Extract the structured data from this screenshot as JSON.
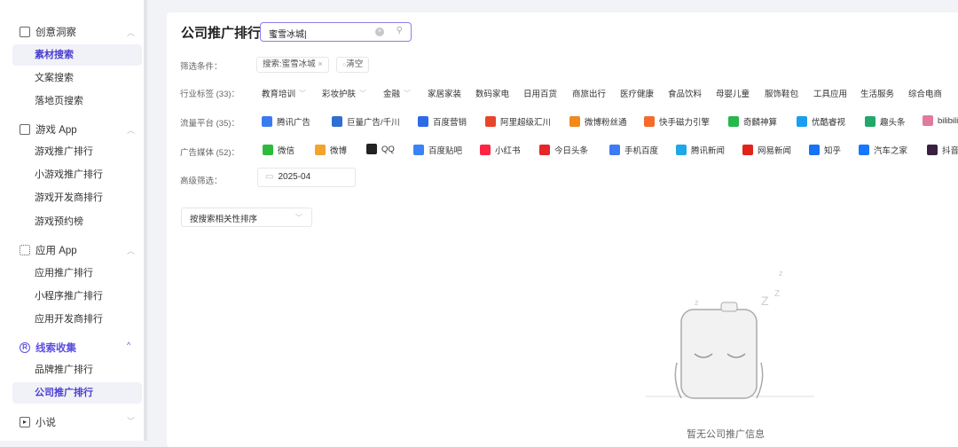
{
  "sidebar": {
    "groups": [
      {
        "label": "创意洞察",
        "items": [
          "素材搜索",
          "文案搜索",
          "落地页搜索"
        ]
      },
      {
        "label": "游戏 App",
        "items": [
          "游戏推广排行",
          "小游戏推广排行",
          "游戏开发商排行",
          "游戏预约榜"
        ]
      },
      {
        "label": "应用 App",
        "items": [
          "应用推广排行",
          "小程序推广排行",
          "应用开发商排行"
        ]
      },
      {
        "label": "线索收集",
        "items": [
          "品牌推广排行",
          "公司推广排行"
        ]
      },
      {
        "label": "小说",
        "items": []
      }
    ]
  },
  "main": {
    "title": "公司推广排行",
    "search": {
      "value": "蜜雪冰城"
    },
    "filter_label": "筛选条件：",
    "filter_chip": "搜索:蜜雪冰城",
    "clear_label": "清空",
    "industry_label": "行业标签 (33)：",
    "industry": [
      "教育培训",
      "彩妆护肤",
      "金融",
      "家居家装",
      "数码家电",
      "日用百货",
      "商旅出行",
      "医疗健康",
      "食品饮料",
      "母婴儿童",
      "服饰鞋包",
      "工具应用",
      "生活服务",
      "综合电商"
    ],
    "platform_label": "流量平台 (35)：",
    "platforms": [
      "腾讯广告",
      "巨量广告/千川",
      "百度营销",
      "阿里超级汇川",
      "微博粉丝通",
      "快手磁力引擎",
      "奇麟神算",
      "优酷睿视",
      "趣头条",
      "bilibili"
    ],
    "media_label": "广告媒体 (52)：",
    "media": [
      "微信",
      "微博",
      "QQ",
      "百度贴吧",
      "小红书",
      "今日头条",
      "手机百度",
      "腾讯新闻",
      "网易新闻",
      "知乎",
      "汽车之家",
      "抖音"
    ],
    "advanced_label": "高级筛选：",
    "date_value": "2025-04",
    "sort_value": "按搜索相关性排序",
    "empty_text": "暂无公司推广信息"
  },
  "colors": {
    "accent": "#5b4ee0"
  }
}
